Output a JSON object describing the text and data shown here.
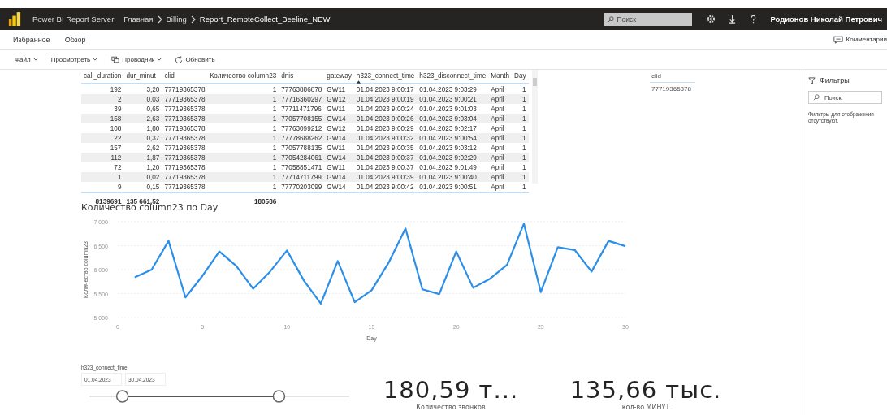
{
  "header": {
    "product": "Power BI Report Server",
    "breadcrumbs": [
      "Главная",
      "Billing",
      "Report_RemoteCollect_Beeline_NEW"
    ],
    "search": {
      "placeholder": "Поиск"
    },
    "user": "Родионов Николай Петрович"
  },
  "nav": {
    "items": [
      "Избранное",
      "Обзор"
    ],
    "comments": "Комментарии"
  },
  "toolbar": [
    {
      "label": "Файл",
      "kind": "menu"
    },
    {
      "label": "Просмотреть",
      "kind": "menu"
    },
    {
      "label": "Проводник",
      "kind": "explorer"
    },
    {
      "label": "Обновить",
      "kind": "refresh"
    }
  ],
  "table": {
    "columns": [
      "call_duration",
      "dur_minut",
      "clid",
      "Количество column23",
      "dnis",
      "gateway",
      "h323_connect_time",
      "h323_disconnect_time",
      "Month",
      "Day"
    ],
    "rows": [
      [
        "192",
        "3,20",
        "77719365378",
        "1",
        "77763886878",
        "GW11",
        "01.04.2023 9:00:17",
        "01.04.2023 9:03:29",
        "April",
        "1"
      ],
      [
        "2",
        "0,03",
        "77719365378",
        "1",
        "77716360297",
        "GW12",
        "01.04.2023 9:00:19",
        "01.04.2023 9:00:21",
        "April",
        "1"
      ],
      [
        "39",
        "0,65",
        "77719365378",
        "1",
        "77711471796",
        "GW11",
        "01.04.2023 9:00:24",
        "01.04.2023 9:01:03",
        "April",
        "1"
      ],
      [
        "158",
        "2,63",
        "77719365378",
        "1",
        "77057708155",
        "GW14",
        "01.04.2023 9:00:26",
        "01.04.2023 9:03:04",
        "April",
        "1"
      ],
      [
        "108",
        "1,80",
        "77719365378",
        "1",
        "77763099212",
        "GW12",
        "01.04.2023 9:00:29",
        "01.04.2023 9:02:17",
        "April",
        "1"
      ],
      [
        "22",
        "0,37",
        "77719365378",
        "1",
        "77778688262",
        "GW14",
        "01.04.2023 9:00:32",
        "01.04.2023 9:00:54",
        "April",
        "1"
      ],
      [
        "157",
        "2,62",
        "77719365378",
        "1",
        "77057788135",
        "GW11",
        "01.04.2023 9:00:35",
        "01.04.2023 9:03:12",
        "April",
        "1"
      ],
      [
        "112",
        "1,87",
        "77719365378",
        "1",
        "77054284061",
        "GW14",
        "01.04.2023 9:00:37",
        "01.04.2023 9:02:29",
        "April",
        "1"
      ],
      [
        "72",
        "1,20",
        "77719365378",
        "1",
        "77058851471",
        "GW11",
        "01.04.2023 9:00:37",
        "01.04.2023 9:01:49",
        "April",
        "1"
      ],
      [
        "1",
        "0,02",
        "77719365378",
        "1",
        "77714711799",
        "GW14",
        "01.04.2023 9:00:39",
        "01.04.2023 9:00:40",
        "April",
        "1"
      ],
      [
        "9",
        "0,15",
        "77719365378",
        "1",
        "77770203099",
        "GW14",
        "01.04.2023 9:00:42",
        "01.04.2023 9:00:51",
        "April",
        "1"
      ]
    ],
    "totals": {
      "call_duration": "8139691",
      "dur_minut": "135 661,52",
      "count_column23": "180586"
    }
  },
  "clid_slicer": {
    "title": "clid",
    "value": "77719365378"
  },
  "chart": {
    "chart_data": {
      "type": "line",
      "title": "Количество column23 по Day",
      "xlabel": "Day",
      "ylabel": "Количество column23",
      "x": [
        1,
        2,
        3,
        4,
        5,
        6,
        7,
        8,
        9,
        10,
        11,
        12,
        13,
        14,
        15,
        16,
        17,
        18,
        19,
        20,
        21,
        22,
        23,
        24,
        25,
        26,
        27,
        28,
        29,
        30
      ],
      "series": [
        {
          "color": "#2b8ee8",
          "values": [
            5840,
            6000,
            6600,
            5420,
            5870,
            6380,
            6080,
            5600,
            5960,
            6400,
            5770,
            5290,
            6180,
            5320,
            5570,
            6140,
            6860,
            5590,
            5490,
            6380,
            5620,
            5810,
            6100,
            6960,
            5530,
            6470,
            6410,
            5960,
            6600,
            6490
          ]
        }
      ],
      "grid": true,
      "xlim": [
        0,
        30
      ],
      "ylim": [
        5000,
        7000
      ],
      "xticks": [
        0,
        5,
        10,
        15,
        20,
        25,
        30
      ],
      "yticks": [
        {
          "value": 5000,
          "label": "5 000"
        },
        {
          "value": 5500,
          "label": "5 500"
        },
        {
          "value": 6000,
          "label": "6 000"
        },
        {
          "value": 6500,
          "label": "6 500"
        },
        {
          "value": 7000,
          "label": "7 000"
        }
      ]
    }
  },
  "date_slicer": {
    "title": "h323_connect_time",
    "from": "01.04.2023",
    "to": "30.04.2023",
    "handles": [
      {
        "level": 0.11
      },
      {
        "level": 0.74
      }
    ]
  },
  "cards": [
    {
      "value": "180,59 т...",
      "label": "Количество звонков"
    },
    {
      "value": "135,66 тыс.",
      "label": "кол-во МИНУТ"
    }
  ],
  "filters": {
    "title": "Фильтры",
    "search": {
      "placeholder": "Поиск"
    },
    "empty_text": "Фильтры для отображения отсутствуют."
  }
}
